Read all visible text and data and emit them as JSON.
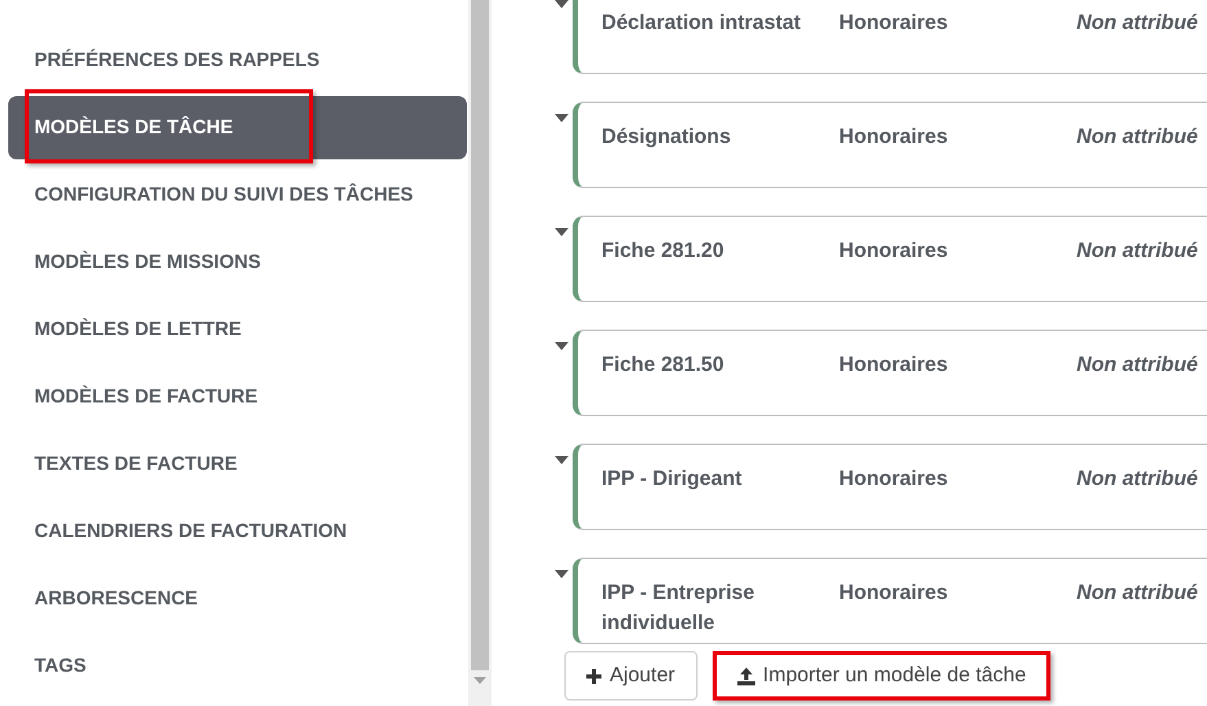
{
  "sidebar": {
    "items": [
      {
        "label": "PRÉFÉRENCES DES RAPPELS",
        "selected": false,
        "highlighted": false
      },
      {
        "label": "MODÈLES DE TÂCHE",
        "selected": true,
        "highlighted": true
      },
      {
        "label": "CONFIGURATION DU SUIVI DES TÂCHES",
        "selected": false,
        "highlighted": false
      },
      {
        "label": "MODÈLES DE MISSIONS",
        "selected": false,
        "highlighted": false
      },
      {
        "label": "MODÈLES DE LETTRE",
        "selected": false,
        "highlighted": false
      },
      {
        "label": "MODÈLES DE FACTURE",
        "selected": false,
        "highlighted": false
      },
      {
        "label": "TEXTES DE FACTURE",
        "selected": false,
        "highlighted": false
      },
      {
        "label": "CALENDRIERS DE FACTURATION",
        "selected": false,
        "highlighted": false
      },
      {
        "label": "ARBORESCENCE",
        "selected": false,
        "highlighted": false
      },
      {
        "label": "TAGS",
        "selected": false,
        "highlighted": false
      }
    ]
  },
  "tasks": [
    {
      "name": "Déclaration intrastat",
      "type": "Honoraires",
      "assignee": "Non attribué"
    },
    {
      "name": "Désignations",
      "type": "Honoraires",
      "assignee": "Non attribué"
    },
    {
      "name": "Fiche 281.20",
      "type": "Honoraires",
      "assignee": "Non attribué"
    },
    {
      "name": "Fiche 281.50",
      "type": "Honoraires",
      "assignee": "Non attribué"
    },
    {
      "name": "IPP - Dirigeant",
      "type": "Honoraires",
      "assignee": "Non attribué"
    },
    {
      "name": "IPP - Entreprise individuelle",
      "type": "Honoraires",
      "assignee": "Non attribué"
    }
  ],
  "actions": [
    {
      "label": "Ajouter",
      "kind": "add",
      "highlighted": false
    },
    {
      "label": "Importer un modèle de tâche",
      "kind": "import",
      "highlighted": true
    }
  ]
}
